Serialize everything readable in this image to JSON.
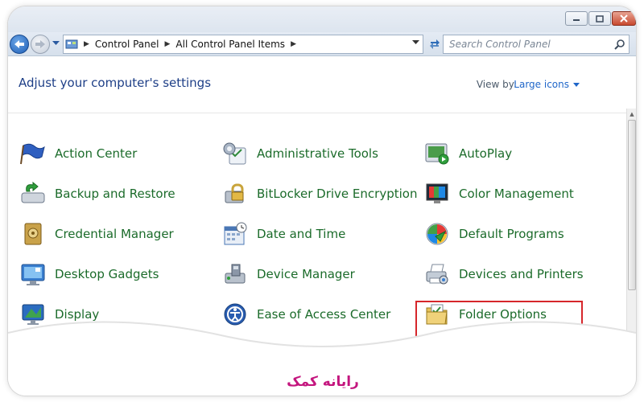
{
  "window": {
    "minimize_icon": "minimize-icon",
    "maximize_icon": "maximize-icon",
    "close_icon": "close-icon"
  },
  "address_bar": {
    "crumbs": [
      "Control Panel",
      "All Control Panel Items"
    ],
    "search_placeholder": "Search Control Panel"
  },
  "header": {
    "title": "Adjust your computer's settings",
    "view_by_label": "View by:",
    "view_by_value": "Large icons"
  },
  "items": [
    {
      "label": "Action Center",
      "icon": "flag-icon"
    },
    {
      "label": "Administrative Tools",
      "icon": "admin-tools-icon"
    },
    {
      "label": "AutoPlay",
      "icon": "autoplay-icon"
    },
    {
      "label": "Backup and Restore",
      "icon": "backup-icon"
    },
    {
      "label": "BitLocker Drive Encryption",
      "icon": "bitlocker-icon"
    },
    {
      "label": "Color Management",
      "icon": "color-management-icon"
    },
    {
      "label": "Credential Manager",
      "icon": "credential-icon"
    },
    {
      "label": "Date and Time",
      "icon": "calendar-clock-icon"
    },
    {
      "label": "Default Programs",
      "icon": "default-programs-icon"
    },
    {
      "label": "Desktop Gadgets",
      "icon": "gadgets-icon"
    },
    {
      "label": "Device Manager",
      "icon": "device-manager-icon"
    },
    {
      "label": "Devices and Printers",
      "icon": "printer-icon"
    },
    {
      "label": "Display",
      "icon": "display-icon"
    },
    {
      "label": "Ease of Access Center",
      "icon": "ease-of-access-icon"
    },
    {
      "label": "Folder Options",
      "icon": "folder-icon"
    }
  ],
  "highlighted_item": "Devices and Printers",
  "colors": {
    "link_green": "#1b6b2a",
    "title_blue": "#1e3f87",
    "highlight_red": "#d6262b",
    "logo_magenta": "#c4167e"
  },
  "watermark": "رایانه کمک"
}
